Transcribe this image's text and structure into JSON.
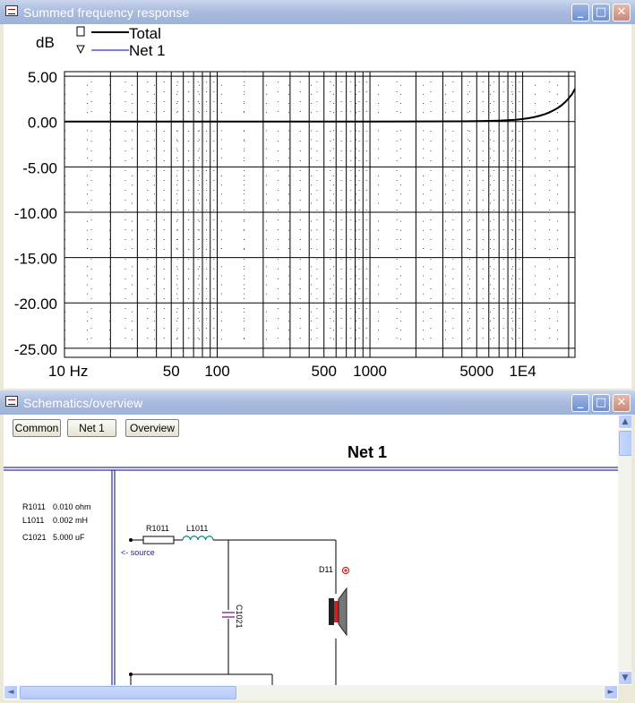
{
  "freq_window": {
    "title": "Summed frequency response",
    "controls": {
      "minimize": "_",
      "maximize": "□",
      "close": "✕"
    }
  },
  "chart_data": {
    "type": "line",
    "ylabel": "dB",
    "x_scale": "log",
    "xlim": [
      10,
      22000
    ],
    "ylim": [
      -26,
      5.5
    ],
    "y_ticks": [
      5,
      0,
      -5,
      -10,
      -15,
      -20,
      -25
    ],
    "y_tick_labels": [
      "5.00",
      "0.00",
      "-5.00",
      "-10.00",
      "-15.00",
      "-20.00",
      "-25.00"
    ],
    "x_ticks": [
      10,
      50,
      100,
      500,
      1000,
      5000,
      10000
    ],
    "x_tick_labels": [
      "10 Hz",
      "50",
      "100",
      "500",
      "1000",
      "5000",
      "1E4"
    ],
    "grid": true,
    "legend_position": "top-left",
    "series": [
      {
        "name": "Total",
        "color": "#000000",
        "marker": "square",
        "x": [
          10,
          100,
          1000,
          4000,
          5000,
          6000,
          7000,
          8000,
          9000,
          10000,
          11000,
          12000,
          13000,
          14000,
          15000,
          16000,
          17000,
          18000,
          19000,
          20000,
          21000,
          22000
        ],
        "y": [
          0,
          0,
          0,
          0.02,
          0.04,
          0.07,
          0.1,
          0.14,
          0.2,
          0.28,
          0.38,
          0.5,
          0.65,
          0.82,
          1.02,
          1.25,
          1.5,
          1.8,
          2.15,
          2.55,
          3.0,
          3.6
        ]
      },
      {
        "name": "Net 1",
        "color": "#0000cc",
        "marker": "triangle",
        "x": [
          10,
          100,
          1000,
          4000,
          5000,
          6000,
          7000,
          8000,
          9000,
          10000,
          11000,
          12000,
          13000,
          14000,
          15000,
          16000,
          17000,
          18000,
          19000,
          20000,
          21000,
          22000
        ],
        "y": [
          0,
          0,
          0,
          0.02,
          0.04,
          0.07,
          0.1,
          0.14,
          0.2,
          0.28,
          0.38,
          0.5,
          0.65,
          0.82,
          1.02,
          1.25,
          1.5,
          1.8,
          2.15,
          2.55,
          3.0,
          3.6
        ]
      }
    ]
  },
  "schem_window": {
    "title": "Schematics/overview",
    "controls": {
      "minimize": "_",
      "maximize": "□",
      "close": "✕"
    },
    "buttons": {
      "common": "Common",
      "net1": "Net 1",
      "overview": "Overview"
    },
    "heading": "Net 1",
    "component_values": [
      {
        "ref": "R1011",
        "value": "0.010 ohm"
      },
      {
        "ref": "L1011",
        "value": "0.002 mH"
      },
      {
        "ref": "C1021",
        "value": "5.000 uF"
      }
    ],
    "labels": {
      "r": "R1011",
      "l": "L1011",
      "c": "C1021",
      "d": "D11",
      "source": "<- source"
    },
    "scroll": {
      "up": "▲",
      "down": "▼",
      "left": "◄",
      "right": "►"
    }
  }
}
